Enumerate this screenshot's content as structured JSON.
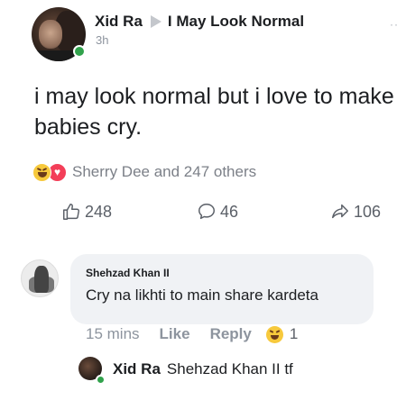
{
  "post": {
    "author": "Xid Ra",
    "group": "I May Look Normal",
    "time": "3h",
    "more": "··",
    "text": "i may look normal but i love to make babies cry.",
    "reactions": {
      "types": [
        "haha",
        "love"
      ],
      "summary": "Sherry Dee and 247 others"
    }
  },
  "actions": {
    "likes": "248",
    "comments": "46",
    "shares": "106"
  },
  "comment": {
    "author": "Shehzad Khan II",
    "text": "Cry na likhti to main share kardeta",
    "time": "15 mins",
    "like_label": "Like",
    "reply_label": "Reply",
    "reaction_type": "haha",
    "reaction_count": "1"
  },
  "reply": {
    "author": "Xid Ra",
    "text": "Shehzad Khan II tf"
  },
  "colors": {
    "online": "#31a24c",
    "haha": "#f7c93c",
    "love": "#f33e58",
    "bubble": "#f0f2f5",
    "muted": "#8d949e"
  }
}
